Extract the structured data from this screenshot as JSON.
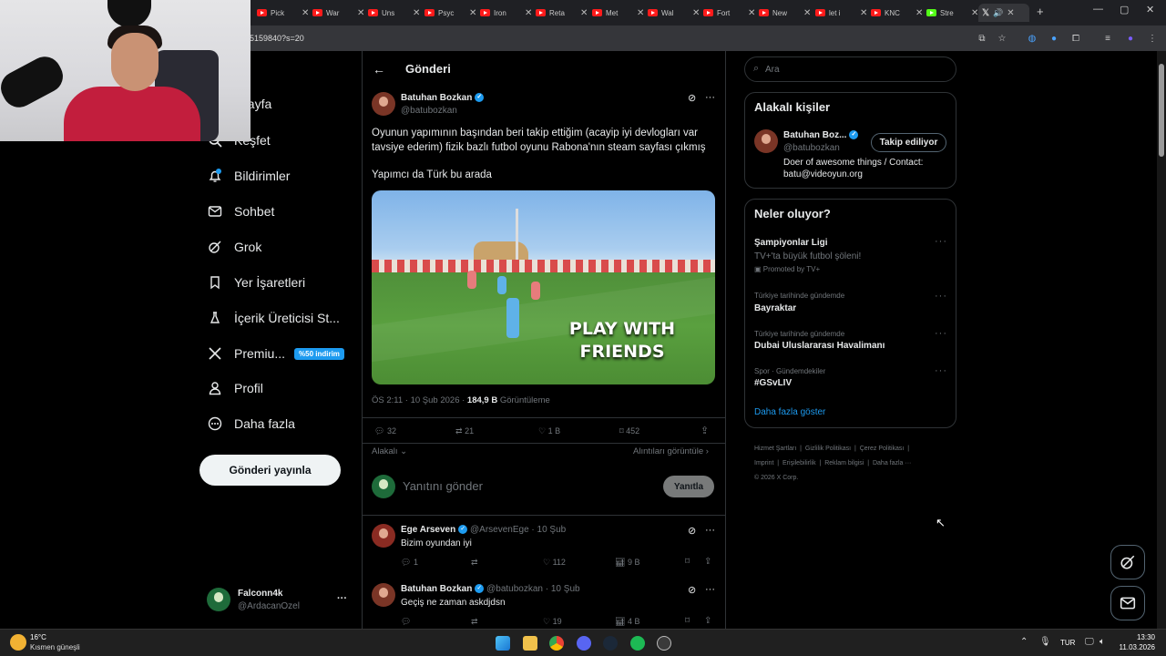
{
  "browser": {
    "tabs": [
      {
        "label": "Pick"
      },
      {
        "label": "War"
      },
      {
        "label": "Uns"
      },
      {
        "label": "Psyc"
      },
      {
        "label": "Iron"
      },
      {
        "label": "Reta"
      },
      {
        "label": "Met"
      },
      {
        "label": "Wal"
      },
      {
        "label": "Fort"
      },
      {
        "label": "New"
      },
      {
        "label": "let i"
      },
      {
        "label": "KNC"
      },
      {
        "label": "Stre"
      }
    ],
    "url_fragment": "5159840?s=20"
  },
  "sidebar": {
    "items": [
      {
        "label": "Anasayfa",
        "visible_label": "asayfa"
      },
      {
        "label": "Keşfet"
      },
      {
        "label": "Bildirimler"
      },
      {
        "label": "Sohbet"
      },
      {
        "label": "Grok"
      },
      {
        "label": "Yer İşaretleri"
      },
      {
        "label": "İçerik Üreticisi St..."
      },
      {
        "label": "Premiu...",
        "badge": "%50 indirim"
      },
      {
        "label": "Profil"
      },
      {
        "label": "Daha fazla"
      }
    ],
    "notification_count": "1",
    "post_button": "Gönderi yayınla",
    "account": {
      "name": "Falconn4k",
      "handle": "@ArdacanOzel",
      "more": "···"
    }
  },
  "main": {
    "header_title": "Gönderi",
    "post": {
      "author": "Batuhan Bozkan",
      "handle": "@batubozkan",
      "text_1": "Oyunun yapımının başından beri takip ettiğim (acayip iyi devlogları var tavsiye ederim) fizik bazlı futbol oyunu Rabona'nın steam sayfası çıkmış",
      "text_2": "Yapımcı da Türk bu arada",
      "media_overlay": "PLAY WITH FRIENDS",
      "meta_time": "ÖS 2:11 · 10 Şub 2026 · ",
      "views_value": "184,9 B",
      "views_label": " Görüntüleme",
      "stats": {
        "replies": "32",
        "reposts": "21",
        "likes": "1 B",
        "bookmarks": "452"
      },
      "related_left": "Alakalı",
      "related_right": "Alıntıları görüntüle"
    },
    "reply_box": {
      "placeholder": "Yanıtını gönder",
      "button": "Yanıtla"
    },
    "replies": [
      {
        "author": "Ege Arseven",
        "handle": "@ArsevenEge · 10 Şub",
        "text": "Bizim oyundan iyi",
        "replies": "1",
        "reposts": "",
        "likes": "112",
        "views": "9 B"
      },
      {
        "author": "Batuhan Bozkan",
        "handle": "@batubozkan · 10 Şub",
        "text": "Geçiş ne zaman askdjdsn",
        "replies": "",
        "reposts": "",
        "likes": "19",
        "views": "4 B"
      }
    ]
  },
  "right": {
    "search_placeholder": "Ara",
    "related_people": {
      "title": "Alakalı kişiler",
      "name": "Batuhan Boz...",
      "handle": "@batubozkan",
      "follow_button": "Takip ediliyor",
      "bio": "Doer of awesome things / Contact: batu@videoyun.org"
    },
    "trends": {
      "title": "Neler oluyor?",
      "items": [
        {
          "context": "",
          "name": "Şampiyonlar Ligi",
          "sub": "TV+'ta büyük futbol şöleni!",
          "promo": "Promoted by TV+"
        },
        {
          "context": "Türkiye tarihinde gündemde",
          "name": "Bayraktar"
        },
        {
          "context": "Türkiye tarihinde gündemde",
          "name": "Dubai Uluslararası Havalimanı"
        },
        {
          "context": "Spor · Gündemdekiler",
          "name": "#GSvLIV"
        }
      ],
      "show_more": "Daha fazla göster"
    },
    "footer": {
      "links": [
        "Hizmet Şartları",
        "Gizlilik Politikası",
        "Çerez Politikası",
        "Imprint",
        "Erişilebilirlik",
        "Reklam bilgisi",
        "Daha fazla ···"
      ],
      "copyright": "© 2026 X Corp."
    }
  },
  "taskbar": {
    "weather_temp": "16°C",
    "weather_desc": "Kısmen güneşli",
    "lang": "TUR",
    "time": "13:30",
    "date": "11.03.2026"
  },
  "colors": {
    "accent": "#1d9bf0",
    "bg": "#000000",
    "border": "#2f3336",
    "muted": "#71767b"
  }
}
